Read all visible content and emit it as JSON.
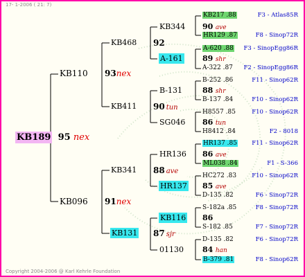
{
  "header": "17- 1-2006 ( 21: 7)",
  "footer": "Copyright 2004-2006 @ Karl Kehrle Foundation",
  "gen1": {
    "code": "KB189",
    "year": "95",
    "suffix": "nex"
  },
  "gen2": [
    {
      "code": "KB110",
      "year": "93",
      "suffix": "nex"
    },
    {
      "code": "KB096",
      "year": "91",
      "suffix": "nex"
    }
  ],
  "gen3": [
    {
      "code": "KB468",
      "year": "92",
      "suffix": ""
    },
    {
      "code": "KB411",
      "year": "90",
      "suffix": "tun"
    },
    {
      "code": "KB341",
      "year": "88",
      "suffix": "ave"
    },
    {
      "code": "KB131",
      "year": "87",
      "suffix": "sjr"
    }
  ],
  "gen4": [
    {
      "code": "KB344",
      "year": "90",
      "suffix": "ave"
    },
    {
      "code": "A-161",
      "year": "89",
      "suffix": "shr"
    },
    {
      "code": "B-131",
      "year": "88",
      "suffix": "shr"
    },
    {
      "code": "SG046",
      "year": "86",
      "suffix": "tun"
    },
    {
      "code": "HR136",
      "year": "86",
      "suffix": "ave"
    },
    {
      "code": "HR137",
      "year": "85",
      "suffix": "ave"
    },
    {
      "code": "KB116",
      "year": "86",
      "suffix": ""
    },
    {
      "code": "01130",
      "year": "84",
      "suffix": "han"
    }
  ],
  "gen5": [
    {
      "code": "KB217 .88",
      "right": "F3 - Atlas85R"
    },
    {
      "code": "HR129 .87",
      "right": "F8 - Sinop72R"
    },
    {
      "code": "A-620 .88",
      "right": "F3 - SinopEgg86R"
    },
    {
      "code": "A-322 .87",
      "right": "F2 - SinopEgg86R"
    },
    {
      "code": "B-252 .86",
      "right": "F11 - Sinop62R"
    },
    {
      "code": "B-137 .84",
      "right": "F10 - Sinop62R"
    },
    {
      "code": "H8557 .85",
      "right": "F10 - Sinop62R"
    },
    {
      "code": "H8412 .84",
      "right": "F2 - 8018"
    },
    {
      "code": "HR137 .85",
      "right": "F11 - Sinop62R"
    },
    {
      "code": "ML038 .84",
      "right": "F1 - S-366"
    },
    {
      "code": "HC272 .83",
      "right": "F10 - Sinop62R"
    },
    {
      "code": "D-135 .82",
      "right": "F6 - Sinop72R"
    },
    {
      "code": "S-182a .85",
      "right": "F8 - Sinop72R"
    },
    {
      "code": "S-182 .85",
      "right": "F7 - Sinop72R"
    },
    {
      "code": "D-135 .82",
      "right": "F6 - Sinop72R"
    },
    {
      "code": "B-379 .81",
      "right": "F8 - Sinop62R"
    }
  ],
  "colors": {
    "frame": "#ff00a8",
    "cyan": "#38e8ee",
    "green": "#6fd670",
    "magenta": "#f3b6f3",
    "red": "#e00000",
    "blue": "#0000c8"
  }
}
